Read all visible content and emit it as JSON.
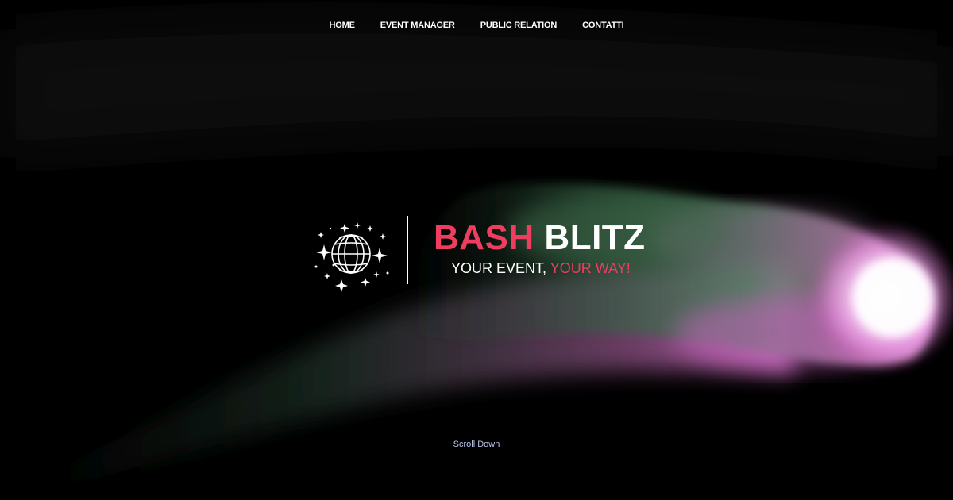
{
  "nav": {
    "items": [
      {
        "label": "HOME"
      },
      {
        "label": "EVENT MANAGER"
      },
      {
        "label": "PUBLIC RELATION"
      },
      {
        "label": "CONTATTI"
      }
    ]
  },
  "brand": {
    "logo_icon": "disco-ball-icon",
    "title_part1": "BASH",
    "title_part2": "BLITZ",
    "tagline_part1": "YOUR EVENT,",
    "tagline_part2": "YOUR WAY!"
  },
  "scroll": {
    "label": "Scroll Down"
  },
  "colors": {
    "accent": "#ef3d5f",
    "smoke_green": "#4a7a5a",
    "smoke_pink": "#e070d0",
    "background": "#000000"
  }
}
